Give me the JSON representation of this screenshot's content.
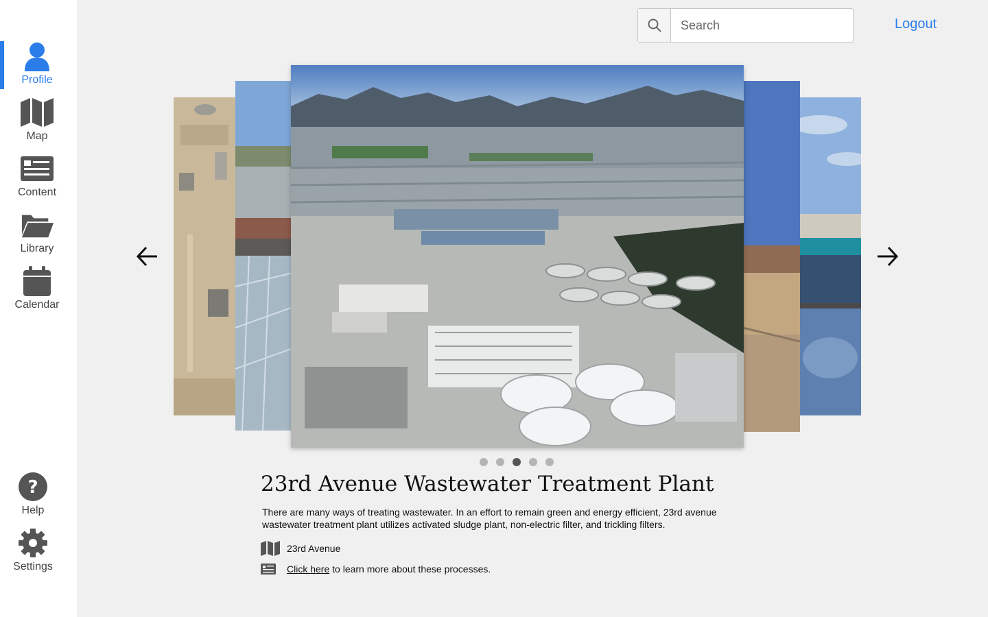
{
  "sidebar": {
    "items": [
      {
        "label": "Profile",
        "icon": "person-icon",
        "active": true
      },
      {
        "label": "Map",
        "icon": "map-icon"
      },
      {
        "label": "Content",
        "icon": "newspaper-icon"
      },
      {
        "label": "Library",
        "icon": "folder-open-icon"
      },
      {
        "label": "Calendar",
        "icon": "calendar-icon"
      }
    ],
    "bottom": [
      {
        "label": "Help",
        "icon": "question-circle-icon"
      },
      {
        "label": "Settings",
        "icon": "gear-icon"
      }
    ]
  },
  "header": {
    "search_placeholder": "Search",
    "logout_label": "Logout"
  },
  "carousel": {
    "slide_count": 5,
    "active_index": 2
  },
  "plant": {
    "title": "23rd Avenue Wastewater Treatment Plant",
    "description": "There are many ways of treating wastewater.  In an effort to remain green and energy efficient, 23rd avenue wastewater treatment plant utilizes activated sludge plant, non-electric filter, and trickling filters.",
    "location": "23rd Avenue",
    "link_text": "Click here",
    "link_suffix": " to learn more about these processes."
  },
  "colors": {
    "accent": "#2b7de9",
    "icon": "#555555",
    "background": "#f0f0f0"
  }
}
